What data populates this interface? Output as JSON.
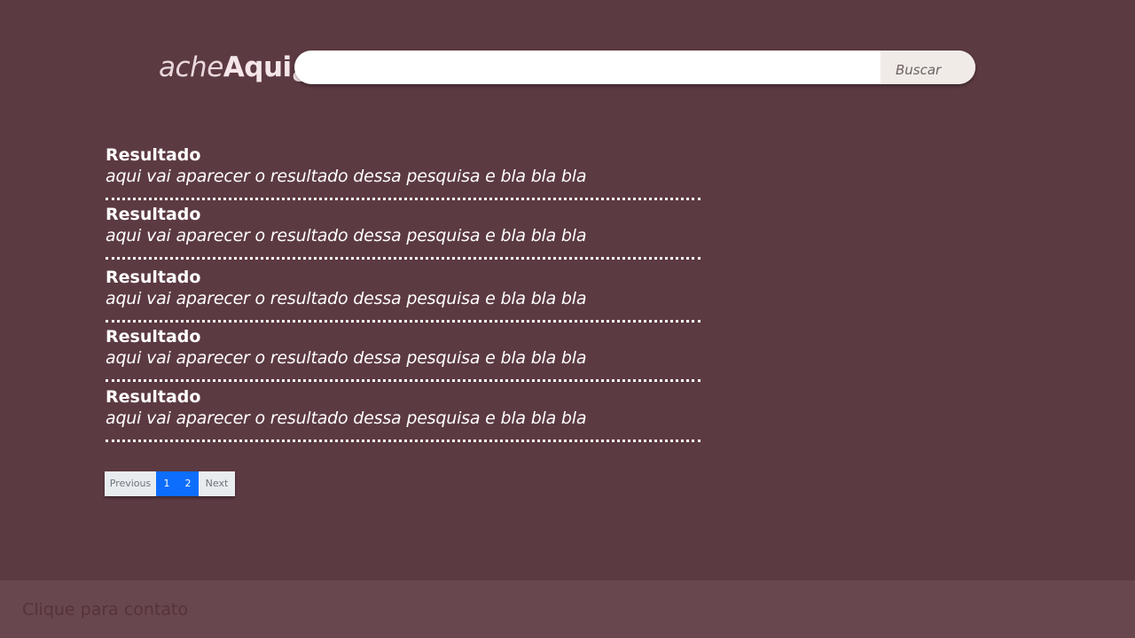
{
  "header": {
    "logo_light": "ache",
    "logo_bold": "Aqui",
    "logo_mark": "¿",
    "search_placeholder": "",
    "search_value": "",
    "search_button_label": "Buscar"
  },
  "results": [
    {
      "title": "Resultado",
      "description": "aqui vai aparecer o resultado dessa pesquisa e bla bla bla"
    },
    {
      "title": "Resultado",
      "description": "aqui vai aparecer o resultado dessa pesquisa e bla bla bla"
    },
    {
      "title": "Resultado",
      "description": "aqui vai aparecer o resultado dessa pesquisa e bla bla bla"
    },
    {
      "title": "Resultado",
      "description": "aqui vai aparecer o resultado dessa pesquisa e bla bla bla"
    },
    {
      "title": "Resultado",
      "description": "aqui vai aparecer o resultado dessa pesquisa e bla bla bla"
    }
  ],
  "pagination": {
    "previous_label": "Previous",
    "pages": [
      "1",
      "2"
    ],
    "next_label": "Next"
  },
  "footer": {
    "contact_label": "Clique para contato"
  },
  "colors": {
    "background": "#5c3a42",
    "footer_background": "#69474e",
    "page_active": "#0d6efd"
  }
}
